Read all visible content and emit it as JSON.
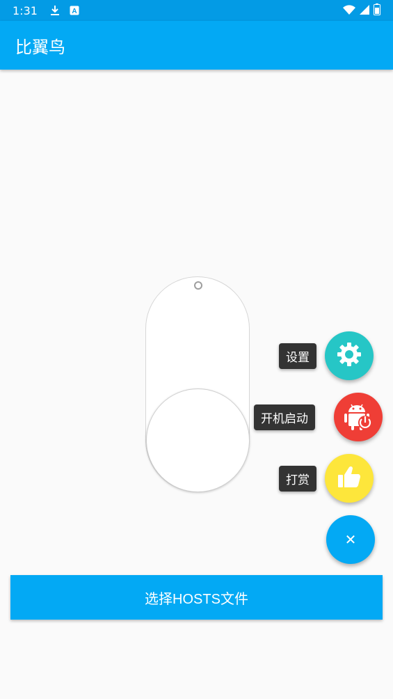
{
  "status_bar": {
    "time": "1:31",
    "icons": [
      "download-icon",
      "a-icon",
      "wifi-icon",
      "signal-icon",
      "battery-icon"
    ]
  },
  "app_bar": {
    "title": "比翼鸟"
  },
  "switch": {
    "state": "off"
  },
  "fab_menu": {
    "items": [
      {
        "label": "设置",
        "icon": "gear-icon",
        "color": "#26c6c6"
      },
      {
        "label": "开机启动",
        "icon": "android-power-icon",
        "color": "#ef3e36"
      },
      {
        "label": "打赏",
        "icon": "thumbs-up-icon",
        "color": "#fde63b"
      }
    ],
    "close": {
      "icon": "close-icon",
      "glyph": "✕",
      "color": "#03a9f4"
    }
  },
  "primary_button": {
    "label": "选择HOSTS文件"
  }
}
